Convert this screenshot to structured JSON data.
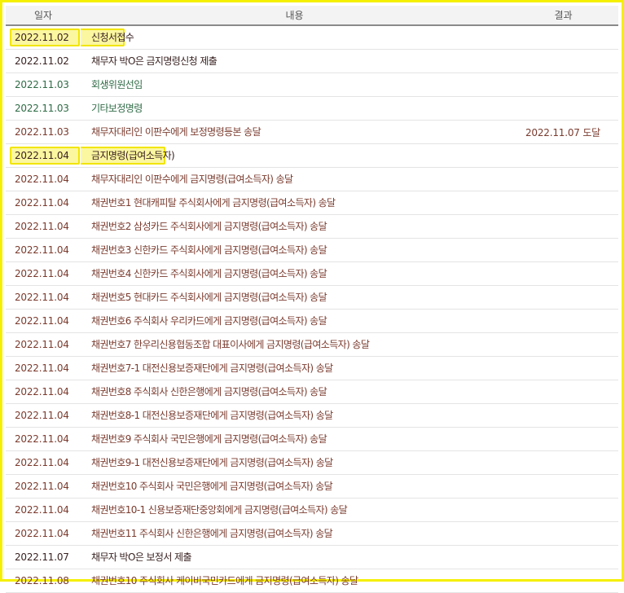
{
  "table": {
    "headers": {
      "date": "일자",
      "content": "내용",
      "result": "결과"
    },
    "colors": {
      "brown": "#7a3b2e",
      "green": "#2f6b46",
      "dark": "#3a2222",
      "highlight_border": "#f2e500",
      "highlight_fill": "#fbf6a0"
    },
    "rows": [
      {
        "date": "2022.11.02",
        "content": "신청서접수",
        "result": "",
        "tone": "dark",
        "highlight": true
      },
      {
        "date": "2022.11.02",
        "content": "채무자 박O은 금지명령신청 제출",
        "result": "",
        "tone": "dark",
        "highlight": false
      },
      {
        "date": "2022.11.03",
        "content": "회생위원선임",
        "result": "",
        "tone": "green",
        "highlight": false
      },
      {
        "date": "2022.11.03",
        "content": "기타보정명령",
        "result": "",
        "tone": "green",
        "highlight": false
      },
      {
        "date": "2022.11.03",
        "content": "채무자대리인 이판수에게 보정명령등본 송달",
        "result": "2022.11.07 도달",
        "tone": "brown",
        "highlight": false
      },
      {
        "date": "2022.11.04",
        "content": "금지명령(급여소득자)",
        "result": "",
        "tone": "dark",
        "highlight": true
      },
      {
        "date": "2022.11.04",
        "content": "채무자대리인 이판수에게 금지명령(급여소득자) 송달",
        "result": "",
        "tone": "brown",
        "highlight": false
      },
      {
        "date": "2022.11.04",
        "content": "채권번호1 현대캐피탈 주식회사에게 금지명령(급여소득자) 송달",
        "result": "",
        "tone": "brown",
        "highlight": false
      },
      {
        "date": "2022.11.04",
        "content": "채권번호2 삼성카드 주식회사에게 금지명령(급여소득자) 송달",
        "result": "",
        "tone": "brown",
        "highlight": false
      },
      {
        "date": "2022.11.04",
        "content": "채권번호3 신한카드 주식회사에게 금지명령(급여소득자) 송달",
        "result": "",
        "tone": "brown",
        "highlight": false
      },
      {
        "date": "2022.11.04",
        "content": "채권번호4 신한카드 주식회사에게 금지명령(급여소득자) 송달",
        "result": "",
        "tone": "brown",
        "highlight": false
      },
      {
        "date": "2022.11.04",
        "content": "채권번호5 현대카드 주식회사에게 금지명령(급여소득자) 송달",
        "result": "",
        "tone": "brown",
        "highlight": false
      },
      {
        "date": "2022.11.04",
        "content": "채권번호6 주식회사 우리카드에게 금지명령(급여소득자) 송달",
        "result": "",
        "tone": "brown",
        "highlight": false
      },
      {
        "date": "2022.11.04",
        "content": "채권번호7 한우리신용협동조합 대표이사에게 금지명령(급여소득자) 송달",
        "result": "",
        "tone": "brown",
        "highlight": false
      },
      {
        "date": "2022.11.04",
        "content": "채권번호7-1 대전신용보증재단에게 금지명령(급여소득자) 송달",
        "result": "",
        "tone": "brown",
        "highlight": false
      },
      {
        "date": "2022.11.04",
        "content": "채권번호8 주식회사 신한은행에게 금지명령(급여소득자) 송달",
        "result": "",
        "tone": "brown",
        "highlight": false
      },
      {
        "date": "2022.11.04",
        "content": "채권번호8-1 대전신용보증재단에게 금지명령(급여소득자) 송달",
        "result": "",
        "tone": "brown",
        "highlight": false
      },
      {
        "date": "2022.11.04",
        "content": "채권번호9 주식회사 국민은행에게 금지명령(급여소득자) 송달",
        "result": "",
        "tone": "brown",
        "highlight": false
      },
      {
        "date": "2022.11.04",
        "content": "채권번호9-1 대전신용보증재단에게 금지명령(급여소득자) 송달",
        "result": "",
        "tone": "brown",
        "highlight": false
      },
      {
        "date": "2022.11.04",
        "content": "채권번호10 주식회사 국민은행에게 금지명령(급여소득자) 송달",
        "result": "",
        "tone": "brown",
        "highlight": false
      },
      {
        "date": "2022.11.04",
        "content": "채권번호10-1 신용보증재단중앙회에게 금지명령(급여소득자) 송달",
        "result": "",
        "tone": "brown",
        "highlight": false
      },
      {
        "date": "2022.11.04",
        "content": "채권번호11 주식회사 신한은행에게 금지명령(급여소득자) 송달",
        "result": "",
        "tone": "brown",
        "highlight": false
      },
      {
        "date": "2022.11.07",
        "content": "채무자 박O은 보정서 제출",
        "result": "",
        "tone": "dark",
        "highlight": false
      },
      {
        "date": "2022.11.08",
        "content": "채권번호10 주식회사 케이비국민카드에게 금지명령(급여소득자) 송달",
        "result": "",
        "tone": "brown",
        "highlight": false
      }
    ]
  }
}
